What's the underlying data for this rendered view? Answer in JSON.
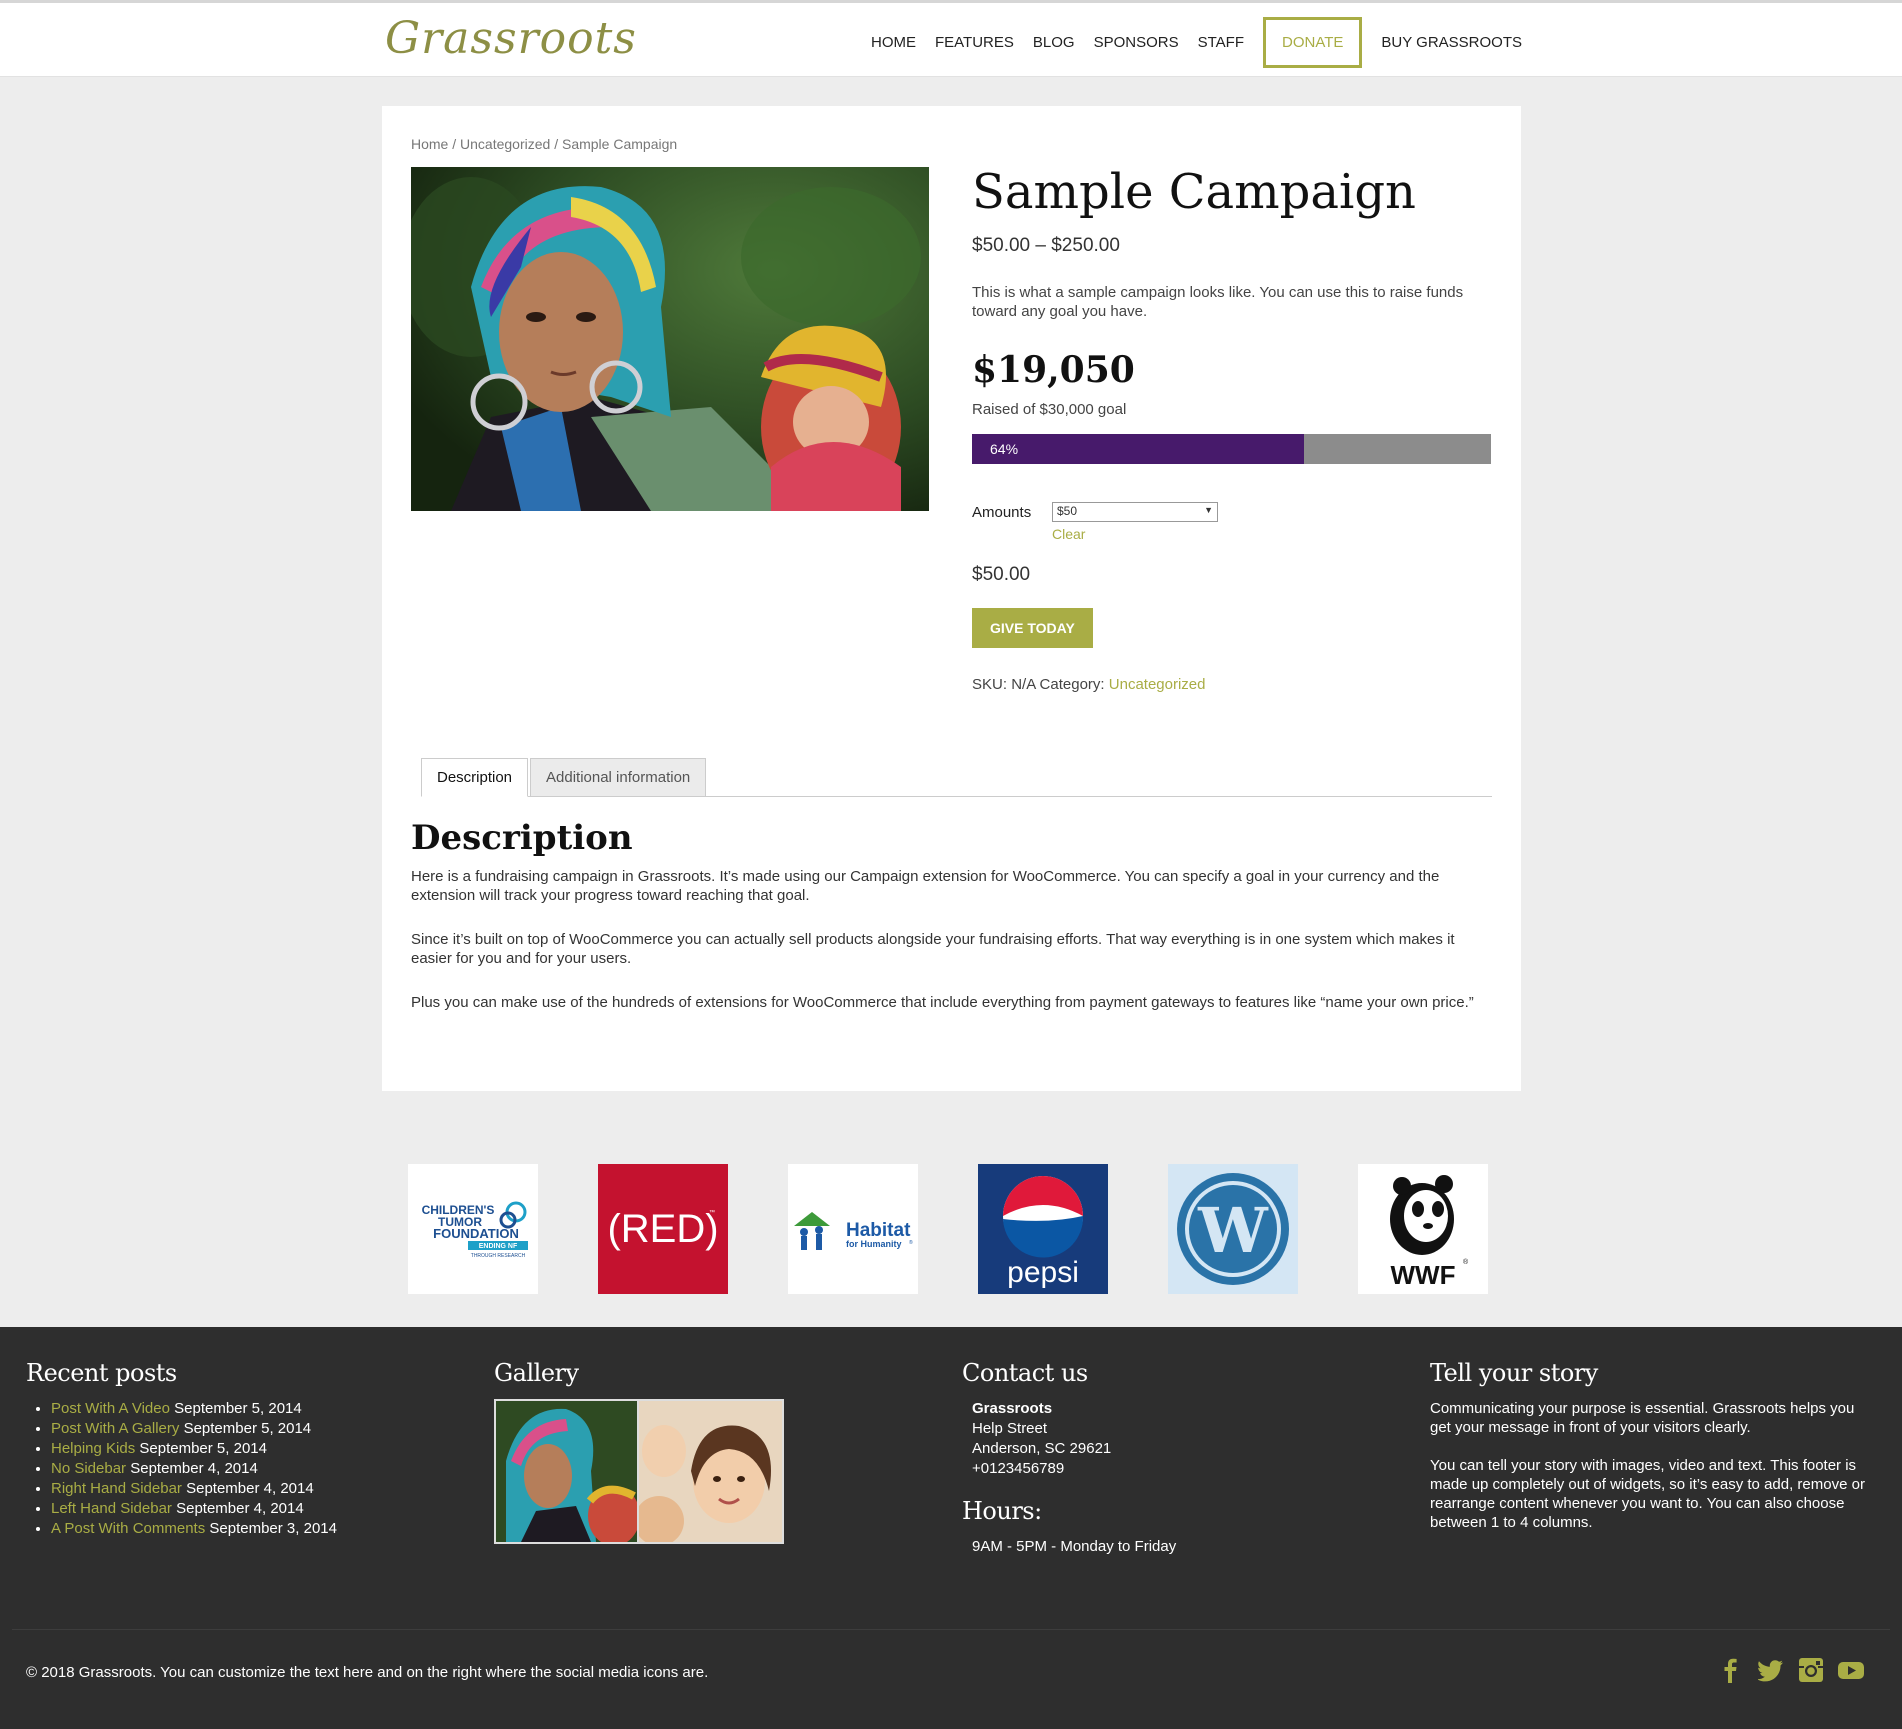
{
  "site": {
    "logo_text": "Grassroots",
    "nav": [
      {
        "label": "HOME"
      },
      {
        "label": "FEATURES"
      },
      {
        "label": "BLOG"
      },
      {
        "label": "SPONSORS"
      },
      {
        "label": "STAFF"
      },
      {
        "label": "DONATE"
      },
      {
        "label": "BUY GRASSROOTS"
      }
    ]
  },
  "breadcrumb": {
    "home": "Home",
    "sep1": " / ",
    "category": "Uncategorized",
    "sep2": " / ",
    "current": "Sample Campaign"
  },
  "product": {
    "title": "Sample Campaign",
    "price_range": "$50.00 – $250.00",
    "short_description": "This is what a sample campaign looks like. You can use this to raise funds toward any goal you have.",
    "raised_amount": "$19,050",
    "raised_label": "Raised of $30,000 goal",
    "progress_percent": 64,
    "progress_label": "64%",
    "amounts_label": "Amounts",
    "amounts_selected": "$50",
    "clear_label": "Clear",
    "selected_price": "$50.00",
    "give_button": "GIVE TODAY",
    "sku_label": "SKU:",
    "sku_value": "N/A",
    "category_label": "Category:",
    "category_value": "Uncategorized"
  },
  "tabs": [
    {
      "label": "Description",
      "active": true
    },
    {
      "label": "Additional information",
      "active": false
    }
  ],
  "description": {
    "heading": "Description",
    "paragraphs": [
      "Here is a fundraising campaign in Grassroots. It’s made using our Campaign extension for WooCommerce. You can specify a goal in your currency and the extension will track your progress toward reaching that goal.",
      "Since it’s built on top of WooCommerce you can actually sell products alongside your fundraising efforts. That way everything is in one system which makes it easier for you and for your users.",
      "Plus you can make use of the hundreds of extensions for WooCommerce that include everything from payment gateways to features like “name your own price.”"
    ]
  },
  "sponsors": {
    "childrens_tumor": {
      "line1": "CHILDREN'S",
      "line2": "TUMOR",
      "line3": "FOUNDATION",
      "line4": "ENDING NF",
      "line5": "THROUGH RESEARCH"
    },
    "red": {
      "text": "(RED)",
      "tm": "™"
    },
    "habitat": {
      "line1": "Habitat",
      "line2": "for Humanity",
      "reg": "®"
    },
    "pepsi": {
      "text": "pepsi"
    },
    "wordpress": {
      "letter": "W"
    },
    "wwf": {
      "text": "WWF",
      "reg": "®"
    }
  },
  "footer": {
    "recent_posts": {
      "heading": "Recent posts",
      "items": [
        {
          "title": "Post With A Video",
          "date": "September 5, 2014"
        },
        {
          "title": "Post With A Gallery",
          "date": "September 5, 2014"
        },
        {
          "title": "Helping Kids",
          "date": "September 5, 2014"
        },
        {
          "title": "No Sidebar",
          "date": "September 4, 2014"
        },
        {
          "title": "Right Hand Sidebar",
          "date": "September 4, 2014"
        },
        {
          "title": "Left Hand Sidebar",
          "date": "September 4, 2014"
        },
        {
          "title": "A Post With Comments",
          "date": "September 3, 2014"
        }
      ]
    },
    "gallery": {
      "heading": "Gallery"
    },
    "contact": {
      "heading": "Contact us",
      "name": "Grassroots",
      "street": "Help Street",
      "city": "Anderson, SC 29621",
      "phone": "+0123456789",
      "hours_heading": "Hours:",
      "hours": "9AM - 5PM - Monday to Friday"
    },
    "story": {
      "heading": "Tell your story",
      "p1": "Communicating your purpose is essential. Grassroots helps you get your message in front of your visitors clearly.",
      "p2": "You can tell your story with images, video and text. This footer is made up completely out of widgets, so it’s easy to add, remove or rearrange content whenever you want to. You can also choose between 1 to 4 columns."
    },
    "copyright": "© 2018 Grassroots. You can customize the text here and on the right where the social media icons are.",
    "social": [
      "facebook-icon",
      "twitter-icon",
      "instagram-icon",
      "youtube-icon"
    ]
  },
  "colors": {
    "accent": "#a9ad45",
    "progress_fill": "#471a6b",
    "progress_track": "#8c8c8c",
    "footer_bg": "#2e2e2e"
  }
}
